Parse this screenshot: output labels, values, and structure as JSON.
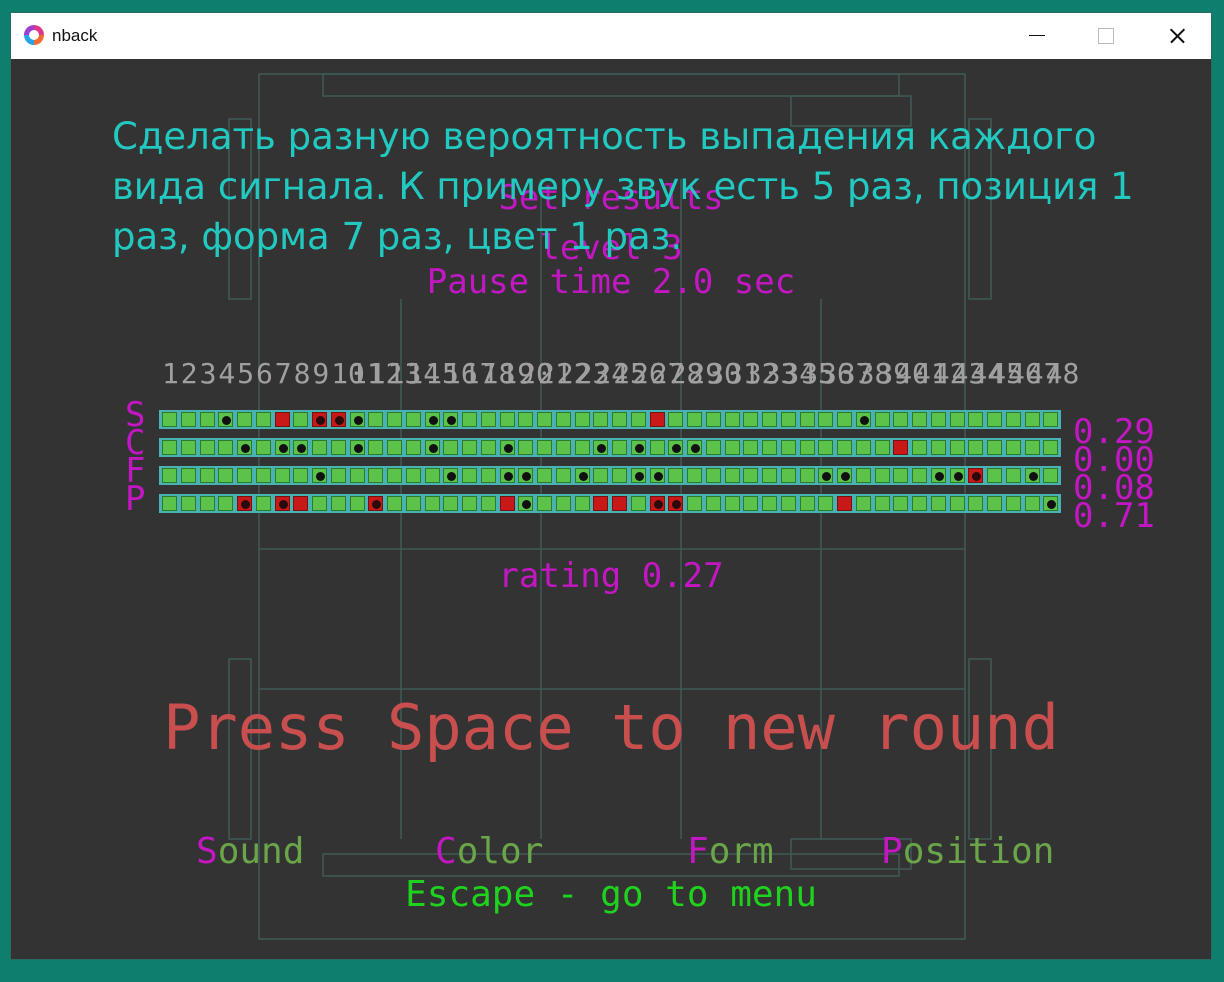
{
  "window": {
    "title": "nback"
  },
  "header": {
    "line1": "Set results",
    "line2": "level 3",
    "line3": "Pause time 2.0 sec"
  },
  "note": "Сделать разную вероятность выпадения каждого вида сигнала. К примеру звук есть 5 раз, позиция 1 раз, форма 7 раз, цвет 1 раз.",
  "results": {
    "column_numbers": [
      "1",
      "2",
      "3",
      "4",
      "5",
      "6",
      "7",
      "8",
      "9",
      "10",
      "11",
      "12",
      "13",
      "14",
      "15",
      "16",
      "17",
      "18",
      "19",
      "20",
      "21",
      "22",
      "23",
      "24",
      "25",
      "26",
      "27",
      "28",
      "29",
      "30",
      "31",
      "32",
      "33",
      "34",
      "35",
      "36",
      "37",
      "38",
      "39",
      "40",
      "41",
      "42",
      "43",
      "44",
      "45",
      "46",
      "47",
      "48"
    ],
    "rows": [
      {
        "letter": "S",
        "score": "0.29",
        "cells": [
          0,
          0,
          0,
          1,
          0,
          0,
          2,
          0,
          3,
          3,
          1,
          0,
          0,
          0,
          1,
          1,
          0,
          0,
          0,
          0,
          0,
          0,
          0,
          0,
          0,
          0,
          2,
          0,
          0,
          0,
          0,
          0,
          0,
          0,
          0,
          0,
          0,
          1,
          0,
          0,
          0,
          0,
          0,
          0,
          0,
          0,
          0,
          0
        ]
      },
      {
        "letter": "C",
        "score": "0.00",
        "cells": [
          0,
          0,
          0,
          0,
          1,
          0,
          1,
          1,
          0,
          0,
          1,
          0,
          0,
          0,
          1,
          0,
          0,
          0,
          1,
          0,
          0,
          0,
          0,
          1,
          0,
          1,
          0,
          1,
          1,
          0,
          0,
          0,
          0,
          0,
          0,
          0,
          0,
          0,
          0,
          2,
          0,
          0,
          0,
          0,
          0,
          0,
          0,
          0
        ]
      },
      {
        "letter": "F",
        "score": "0.08",
        "cells": [
          0,
          0,
          0,
          0,
          0,
          0,
          0,
          0,
          1,
          0,
          0,
          0,
          0,
          0,
          0,
          1,
          0,
          0,
          1,
          1,
          0,
          0,
          1,
          0,
          0,
          1,
          1,
          0,
          0,
          0,
          0,
          0,
          0,
          0,
          0,
          1,
          1,
          0,
          0,
          0,
          0,
          1,
          1,
          3,
          0,
          0,
          1,
          0
        ]
      },
      {
        "letter": "P",
        "score": "0.71",
        "cells": [
          0,
          0,
          0,
          0,
          3,
          0,
          3,
          2,
          0,
          0,
          0,
          3,
          0,
          0,
          0,
          0,
          0,
          0,
          2,
          1,
          0,
          0,
          0,
          2,
          2,
          0,
          3,
          3,
          0,
          0,
          0,
          0,
          0,
          0,
          0,
          0,
          2,
          0,
          0,
          0,
          0,
          0,
          0,
          0,
          0,
          0,
          0,
          1
        ]
      }
    ],
    "rating": "rating 0.27"
  },
  "prompt": "Press Space to new round",
  "keys": [
    {
      "hotkey": "S",
      "rest": "ound"
    },
    {
      "hotkey": "C",
      "rest": "olor"
    },
    {
      "hotkey": "F",
      "rest": "orm"
    },
    {
      "hotkey": "P",
      "rest": "osition"
    }
  ],
  "escape": "Escape - go to menu",
  "colors": {
    "background": "#333333",
    "note": "#22c9c0",
    "magenta": "#c417c4",
    "cell_green": "#5bc24a",
    "cell_red": "#c81818",
    "prompt_red": "#c94f4f",
    "escape_green": "#1ed21e"
  }
}
